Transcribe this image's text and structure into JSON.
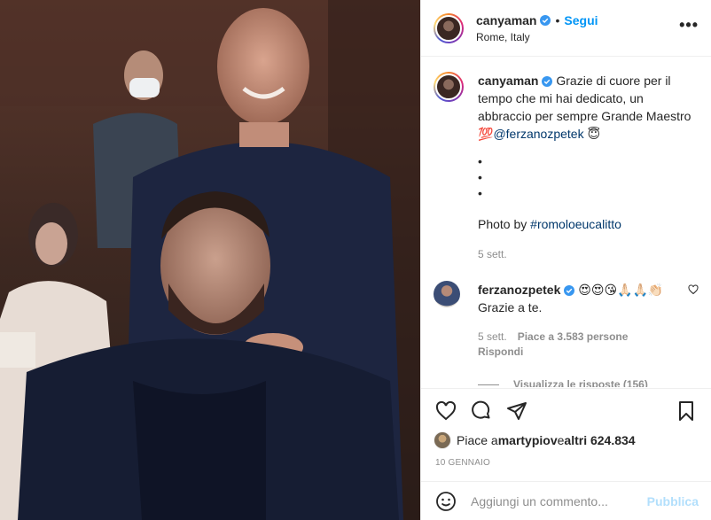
{
  "post": {
    "username": "canyaman",
    "follow_label": "Segui",
    "separator": "•",
    "location": "Rome, Italy",
    "more_label": "•••"
  },
  "caption": {
    "username": "canyaman",
    "text": "Grazie di cuore per il tempo che mi hai dedicato, un abbraccio per sempre Grande Maestro",
    "emoji_100": "💯",
    "mention": "@ferzanozpetek",
    "emoji_halo": "😇",
    "dots": [
      "•",
      "•",
      "•"
    ],
    "photo_by_prefix": "Photo by ",
    "hashtag": "#romoloeucalitto",
    "time": "5 sett."
  },
  "comment": {
    "username": "ferzanozpetek",
    "emojis": "😍😍😘🙏🏻🙏🏻👏🏻",
    "text": "Grazie a te.",
    "time": "5 sett.",
    "likes": "Piace a 3.583 persone",
    "reply_label": "Rispondi",
    "view_replies": "Visualizza le risposte (156)"
  },
  "likes": {
    "prefix": "Piace a ",
    "user": "martypiov",
    "middle": " e ",
    "others": "altri 624.834"
  },
  "date": "10 GENNAIO",
  "add_comment": {
    "placeholder": "Aggiungi un commento...",
    "publish_label": "Pubblica"
  },
  "colors": {
    "link_blue": "#0095f6",
    "verified_blue": "#3897f0",
    "secondary_text": "#8e8e8e",
    "publish_disabled": "#b2dffc"
  },
  "icons": [
    "verified-icon",
    "more-options-icon",
    "heart-icon",
    "comment-icon",
    "share-icon",
    "bookmark-icon",
    "emoji-icon"
  ]
}
